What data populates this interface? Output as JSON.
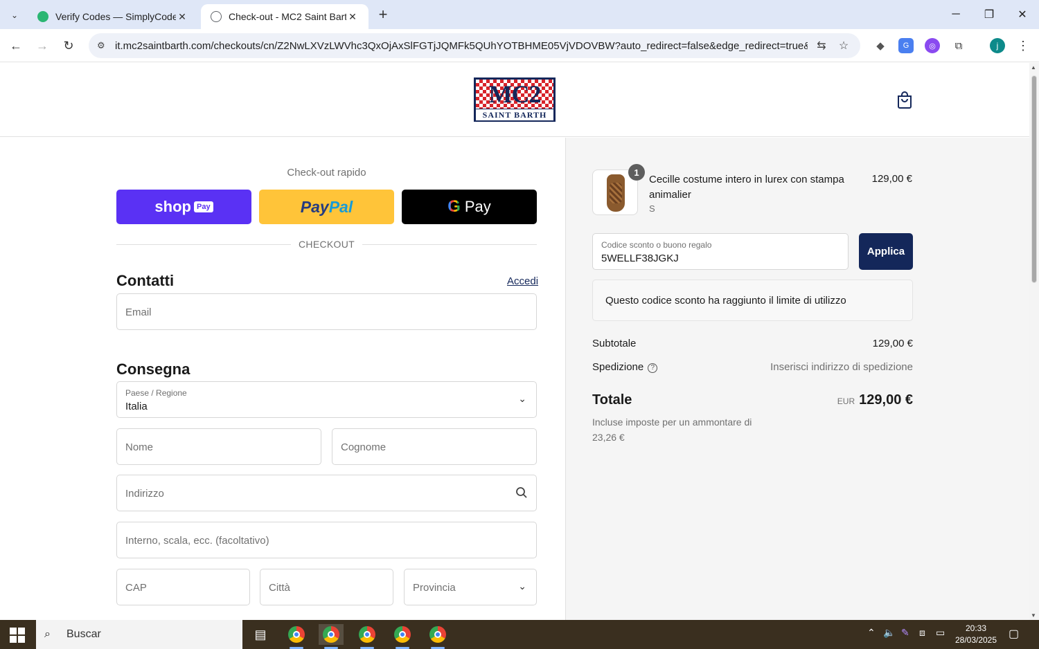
{
  "browser": {
    "tabs": [
      {
        "title": "Verify Codes — SimplyCodes",
        "active": false
      },
      {
        "title": "Check-out - MC2 Saint Barth",
        "active": true
      }
    ],
    "url": "it.mc2saintbarth.com/checkouts/cn/Z2NwLXVzLWVhc3QxOjAxSlFGTjJQMFk5QUhYOTBHME05VjVDOVBW?auto_redirect=false&edge_redirect=true&locale...",
    "profile_initial": "j"
  },
  "header": {
    "logo_mark": "MC2",
    "logo_sub": "SAINT BARTH"
  },
  "checkout": {
    "quick_title": "Check-out rapido",
    "shop_pay": {
      "brand": "shop",
      "tag": "Pay"
    },
    "paypal": {
      "p1": "Pay",
      "p2": "Pal"
    },
    "gpay": {
      "g": "G",
      "label": "Pay"
    },
    "divider": "CHECKOUT",
    "contacts_title": "Contatti",
    "login_link": "Accedi",
    "email_placeholder": "Email",
    "delivery_title": "Consegna",
    "country_label": "Paese / Regione",
    "country_value": "Italia",
    "first_name_placeholder": "Nome",
    "last_name_placeholder": "Cognome",
    "address_placeholder": "Indirizzo",
    "apartment_placeholder": "Interno, scala, ecc. (facoltativo)",
    "zip_placeholder": "CAP",
    "city_placeholder": "Città",
    "province_placeholder": "Provincia"
  },
  "summary": {
    "item": {
      "quantity": "1",
      "name": "Cecille costume intero in lurex con stampa animalier",
      "variant": "S",
      "price": "129,00 €"
    },
    "discount_label": "Codice sconto o buono regalo",
    "discount_value": "5WELLF38JGKJ",
    "apply_label": "Applica",
    "notice": "Questo codice sconto ha raggiunto il limite di utilizzo",
    "subtotal_label": "Subtotale",
    "subtotal_value": "129,00 €",
    "shipping_label": "Spedizione",
    "shipping_value": "Inserisci indirizzo di spedizione",
    "total_label": "Totale",
    "total_currency": "EUR",
    "total_value": "129,00 €",
    "tax_note": "Incluse imposte per un ammontare di 23,26 €"
  },
  "taskbar": {
    "search_placeholder": "Buscar",
    "time": "20:33",
    "date": "28/03/2025"
  }
}
